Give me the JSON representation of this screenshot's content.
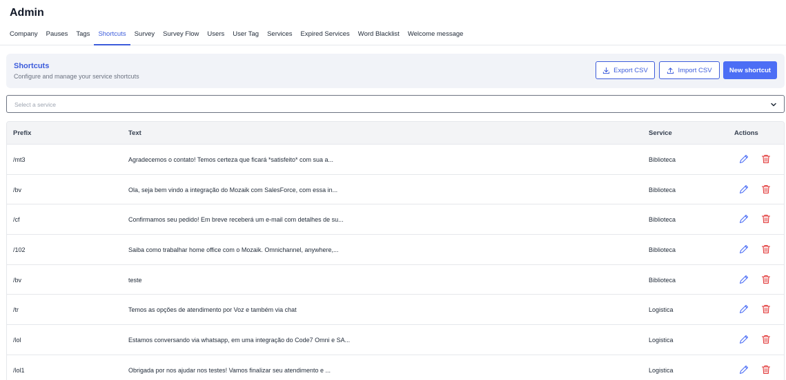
{
  "page": {
    "title": "Admin"
  },
  "tabs": [
    {
      "label": "Company",
      "active": false
    },
    {
      "label": "Pauses",
      "active": false
    },
    {
      "label": "Tags",
      "active": false
    },
    {
      "label": "Shortcuts",
      "active": true
    },
    {
      "label": "Survey",
      "active": false
    },
    {
      "label": "Survey Flow",
      "active": false
    },
    {
      "label": "Users",
      "active": false
    },
    {
      "label": "User Tag",
      "active": false
    },
    {
      "label": "Services",
      "active": false
    },
    {
      "label": "Expired Services",
      "active": false
    },
    {
      "label": "Word Blacklist",
      "active": false
    },
    {
      "label": "Welcome message",
      "active": false
    }
  ],
  "header": {
    "title": "Shortcuts",
    "subtitle": "Configure and manage your service shortcuts",
    "export_label": "Export CSV",
    "import_label": "Import CSV",
    "new_label": "New shortcut"
  },
  "service_select": {
    "placeholder": "Select a service"
  },
  "table": {
    "columns": {
      "prefix": "Prefix",
      "text": "Text",
      "service": "Service",
      "actions": "Actions"
    },
    "rows": [
      {
        "prefix": "/mt3",
        "text": "Agradecemos o contato! Temos certeza que ficará *satisfeito* com sua a...",
        "service": "Biblioteca"
      },
      {
        "prefix": "/bv",
        "text": "Ola, seja bem vindo a integração do Mozaik com SalesForce, com essa in...",
        "service": "Biblioteca"
      },
      {
        "prefix": "/cf",
        "text": "Confirmamos seu pedido! Em breve receberá um e-mail com detalhes de su...",
        "service": "Biblioteca"
      },
      {
        "prefix": "/102",
        "text": "Saiba como trabalhar home office com o Mozaik. Omnichannel, anywhere,...",
        "service": "Biblioteca"
      },
      {
        "prefix": "/bv",
        "text": "teste",
        "service": "Biblioteca"
      },
      {
        "prefix": "/tr",
        "text": "Temos as opções de atendimento por Voz e também via chat",
        "service": "Logistica"
      },
      {
        "prefix": "/lol",
        "text": "Estamos conversando via whatsapp, em uma integração do Code7 Omni e SA...",
        "service": "Logistica"
      },
      {
        "prefix": "/lol1",
        "text": "Obrigada por nos ajudar nos testes! Vamos finalizar seu atendimento e ...",
        "service": "Logistica"
      }
    ]
  },
  "icons": {
    "export": "download-icon",
    "import": "upload-icon",
    "select": "chevron-down-icon",
    "edit": "pencil-icon",
    "delete": "trash-icon"
  },
  "colors": {
    "accent": "#3b5bdb",
    "primary_button": "#4c6ef5",
    "delete": "#e03131",
    "header_bg": "#f1f3f8"
  }
}
